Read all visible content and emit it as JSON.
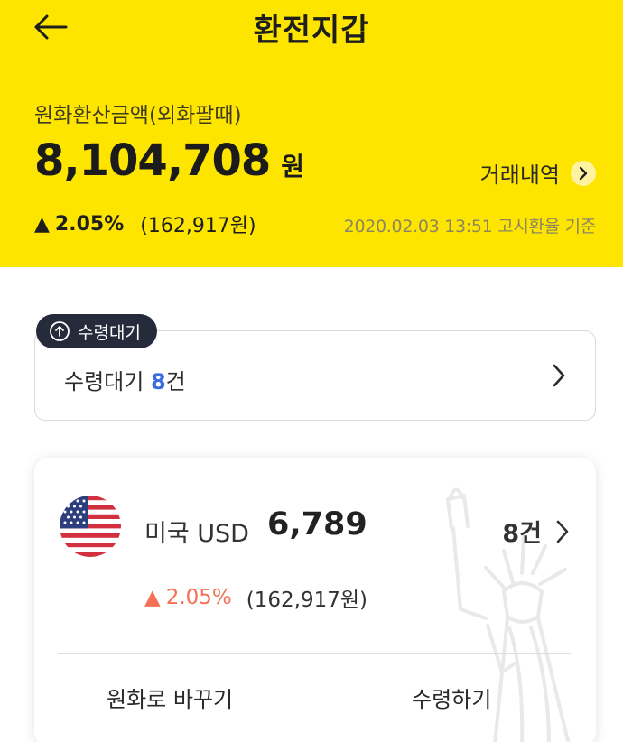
{
  "header": {
    "title": "환전지갑",
    "subtitle": "원화환산금액(외화팔때)",
    "amount": "8,104,708",
    "amount_unit": "원",
    "history_label": "거래내역",
    "change_arrow": "▲",
    "change_pct": "2.05%",
    "change_amount": "(162,917원)",
    "rate_basis": "2020.02.03 13:51 고시환율 기준",
    "background_color": "#fee500"
  },
  "pending": {
    "badge_icon": "upload-circle-icon",
    "badge_label": "수령대기",
    "text_prefix": "수령대기",
    "count": "8",
    "count_suffix": "건",
    "count_color": "#3c6ce0"
  },
  "currency_card": {
    "flag": "us-flag-icon",
    "name": "미국 USD",
    "amount": "6,789",
    "count": "8건",
    "change_arrow": "▲",
    "change_pct": "2.05%",
    "change_amount": "(162,917원)",
    "change_color": "#f47157",
    "action_convert": "원화로 바꾸기",
    "action_receive": "수령하기",
    "watermark": "statue-of-liberty-icon"
  }
}
